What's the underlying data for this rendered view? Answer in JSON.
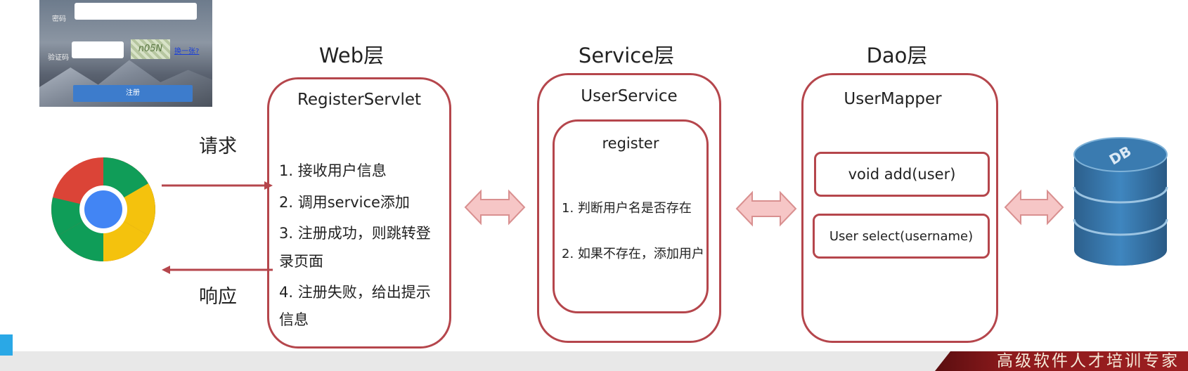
{
  "thumbnail": {
    "password_label": "密码",
    "captcha_label": "验证码",
    "captcha_text": "n05N",
    "refresh_link": "换一张?",
    "register_button": "注册"
  },
  "web_layer": {
    "title": "Web层",
    "component": "RegisterServlet",
    "steps": [
      "1. 接收用户信息",
      "2. 调用service添加",
      "3. 注册成功，则跳转登",
      "录页面",
      "4. 注册失败，给出提示",
      "信息"
    ]
  },
  "service_layer": {
    "title": "Service层",
    "component": "UserService",
    "method": "register",
    "steps": [
      "1. 判断用户名是否存在",
      "2. 如果不存在，添加用户"
    ]
  },
  "dao_layer": {
    "title": "Dao层",
    "component": "UserMapper",
    "methods": [
      "void add(user)",
      "User select(username)"
    ]
  },
  "request_label": "请求",
  "response_label": "响应",
  "db_label": "DB",
  "banner_text": "高级软件人才培训专家",
  "colors": {
    "box_border": "#b5464c",
    "double_arrow_fill": "#f6c6c6",
    "db_blue": "#3a7bb0",
    "banner": "#8e1a1c"
  }
}
